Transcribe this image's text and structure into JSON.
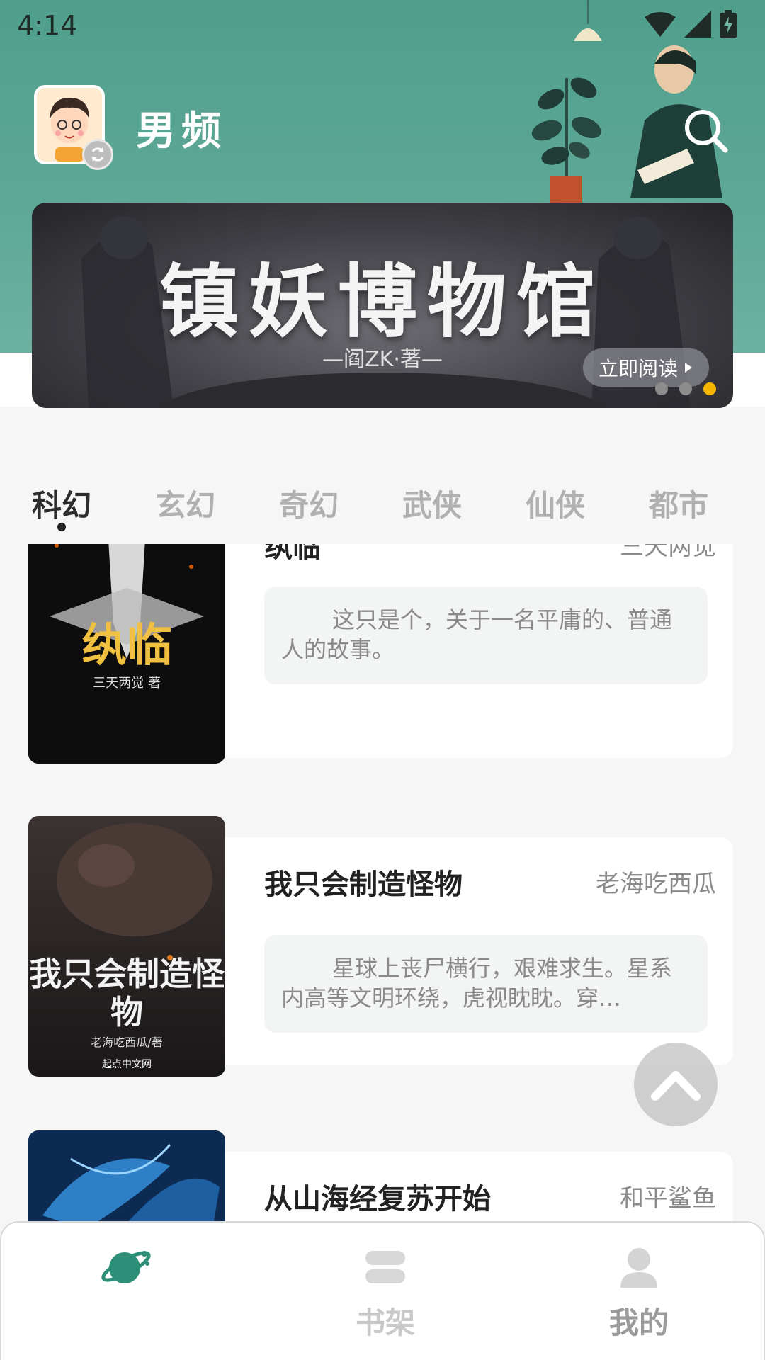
{
  "status_bar": {
    "time": "4:14"
  },
  "header": {
    "channel": "男频"
  },
  "banner": {
    "title": "镇妖博物馆",
    "author": "—阎ZK·著—",
    "read_button": "立即阅读",
    "page_count": 3,
    "active_page": 3
  },
  "tabs": [
    {
      "label": "科幻",
      "active": true
    },
    {
      "label": "玄幻",
      "active": false
    },
    {
      "label": "奇幻",
      "active": false
    },
    {
      "label": "武侠",
      "active": false
    },
    {
      "label": "仙侠",
      "active": false
    },
    {
      "label": "都市",
      "active": false
    }
  ],
  "books": [
    {
      "title": "纨临",
      "author": "三天两觉",
      "description": "这只是个，关于一名平庸的、普通人的故事。",
      "cover_text": "纨临",
      "cover_byline": "三天两觉 著"
    },
    {
      "title": "我只会制造怪物",
      "author": "老海吃西瓜",
      "description": "星球上丧尸横行，艰难求生。星系内高等文明环绕，虎视眈眈。穿…",
      "cover_text": "我只会制造怪物",
      "cover_byline": "老海吃西瓜/著",
      "cover_publisher": "起点中文网"
    },
    {
      "title": "从山海经复苏开始",
      "author": "和平鲨鱼",
      "description": ""
    }
  ],
  "bottom_nav": {
    "bookshelf_label": "书架",
    "mine_label": "我的"
  },
  "colors": {
    "header_green": "#5fa897",
    "accent_green": "#2e8f78",
    "banner_dot_active": "#f4b400"
  }
}
